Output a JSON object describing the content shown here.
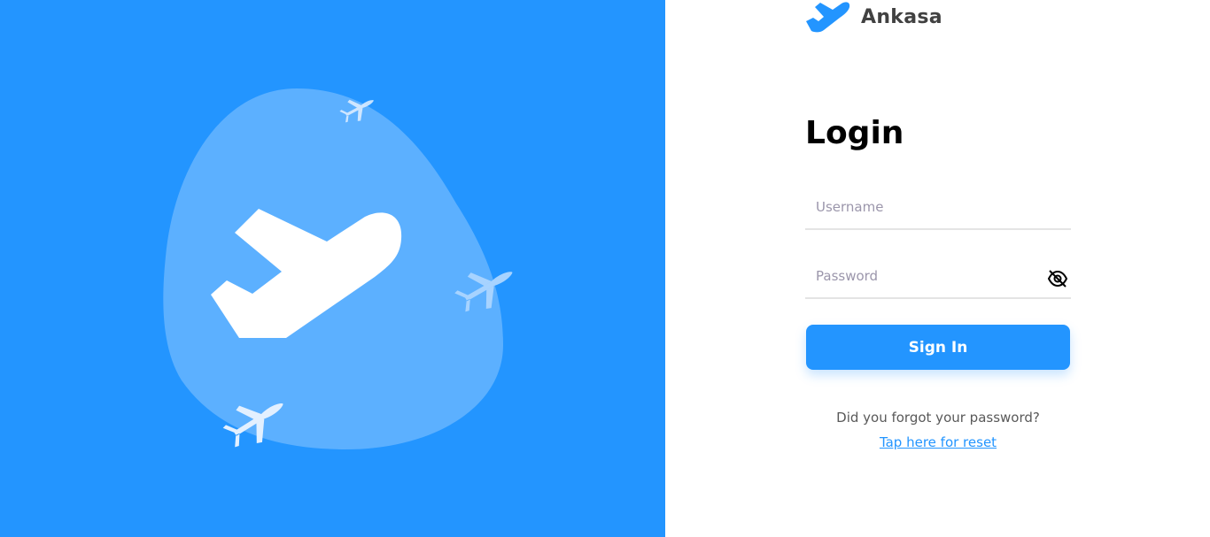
{
  "app": {
    "name": "Ankasa"
  },
  "login": {
    "title": "Login",
    "username_placeholder": "Username",
    "password_placeholder": "Password",
    "signin_label": "Sign In",
    "forgot_text": "Did you forgot your password?",
    "reset_link": "Tap here for reset"
  },
  "icons": {
    "logo": "airplane-icon",
    "password_toggle": "eye-slash-icon"
  },
  "colors": {
    "brand_blue": "#2395ff",
    "blob": "#5cb0ff",
    "text_dark": "#000000",
    "text_muted": "#595959",
    "placeholder": "#9b96ab"
  }
}
